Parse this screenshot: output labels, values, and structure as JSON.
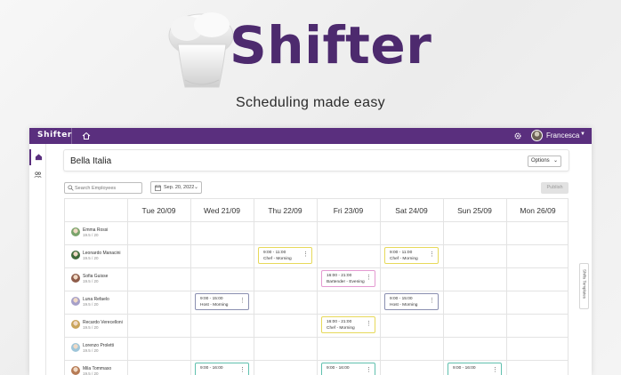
{
  "hero": {
    "title": "Shifter",
    "tagline": "Scheduling made easy"
  },
  "colors": {
    "brand": "#5a2f7e",
    "title": "#4d2a6e",
    "shift_yellow": "#e7d95a",
    "shift_pink": "#e49ad1",
    "shift_purple": "#8a8fb0",
    "shift_teal": "#5fc0ae"
  },
  "topbar": {
    "app_name": "Shifter",
    "user_name": "Francesca",
    "home_icon": "home-icon",
    "settings_icon": "gear-icon"
  },
  "sidebar": {
    "items": [
      {
        "icon": "home-icon"
      },
      {
        "icon": "people-icon"
      }
    ]
  },
  "header": {
    "restaurant": "Bella Italia",
    "options_label": "Options"
  },
  "controls": {
    "search_placeholder": "Search Employees",
    "date": "Sep. 20, 2022",
    "publish_label": "Publish"
  },
  "schedule": {
    "days": [
      "Tue 20/09",
      "Wed 21/09",
      "Thu 22/09",
      "Fri 23/09",
      "Sat 24/09",
      "Sun 25/09",
      "Mon 26/09"
    ],
    "employees": [
      {
        "name": "Emma Rossi",
        "hours": "19.5 / 20",
        "avatar_color": "#7aa36b",
        "shifts": [
          null,
          null,
          null,
          null,
          null,
          null,
          null
        ]
      },
      {
        "name": "Leonardo Manacini",
        "hours": "19.5 / 20",
        "avatar_color": "#3f6a3a",
        "shifts": [
          null,
          null,
          {
            "time": "9:00 - 11:00",
            "role": "Chef - Morning",
            "color": "yellow"
          },
          null,
          {
            "time": "9:00 - 11:00",
            "role": "Chef - Morning",
            "color": "yellow"
          },
          null,
          null
        ]
      },
      {
        "name": "Sofia Guisse",
        "hours": "19.5 / 20",
        "avatar_color": "#8e5c4a",
        "shifts": [
          null,
          null,
          null,
          {
            "time": "16:00 - 21:00",
            "role": "Bartender - Evening",
            "color": "pink"
          },
          null,
          null,
          null
        ]
      },
      {
        "name": "Luna Refaelo",
        "hours": "19.5 / 20",
        "avatar_color": "#a6a0c8",
        "shifts": [
          null,
          {
            "time": "9:00 - 15:00",
            "role": "Host - Morning",
            "color": "purple"
          },
          null,
          null,
          {
            "time": "9:00 - 15:00",
            "role": "Host - Morning",
            "color": "purple"
          },
          null,
          null
        ]
      },
      {
        "name": "Recardo Verecelloni",
        "hours": "19.5 / 20",
        "avatar_color": "#c9a45a",
        "shifts": [
          null,
          null,
          null,
          {
            "time": "16:00 - 21:00",
            "role": "Chef - Morning",
            "color": "yellow"
          },
          null,
          null,
          null
        ]
      },
      {
        "name": "Lorenzo Proletti",
        "hours": "19.5 / 20",
        "avatar_color": "#9fc6d9",
        "shifts": [
          null,
          null,
          null,
          null,
          null,
          null,
          null
        ]
      },
      {
        "name": "Mila Tommaso",
        "hours": "19.5 / 20",
        "avatar_color": "#b67b55",
        "shifts": [
          null,
          {
            "time": "9:00 - 16:00",
            "role": "",
            "color": "teal"
          },
          null,
          {
            "time": "9:00 - 16:00",
            "role": "",
            "color": "teal"
          },
          null,
          {
            "time": "9:00 - 16:00",
            "role": "",
            "color": "teal"
          },
          null
        ]
      }
    ]
  },
  "side_tab": {
    "label": "Shifts Templates"
  }
}
